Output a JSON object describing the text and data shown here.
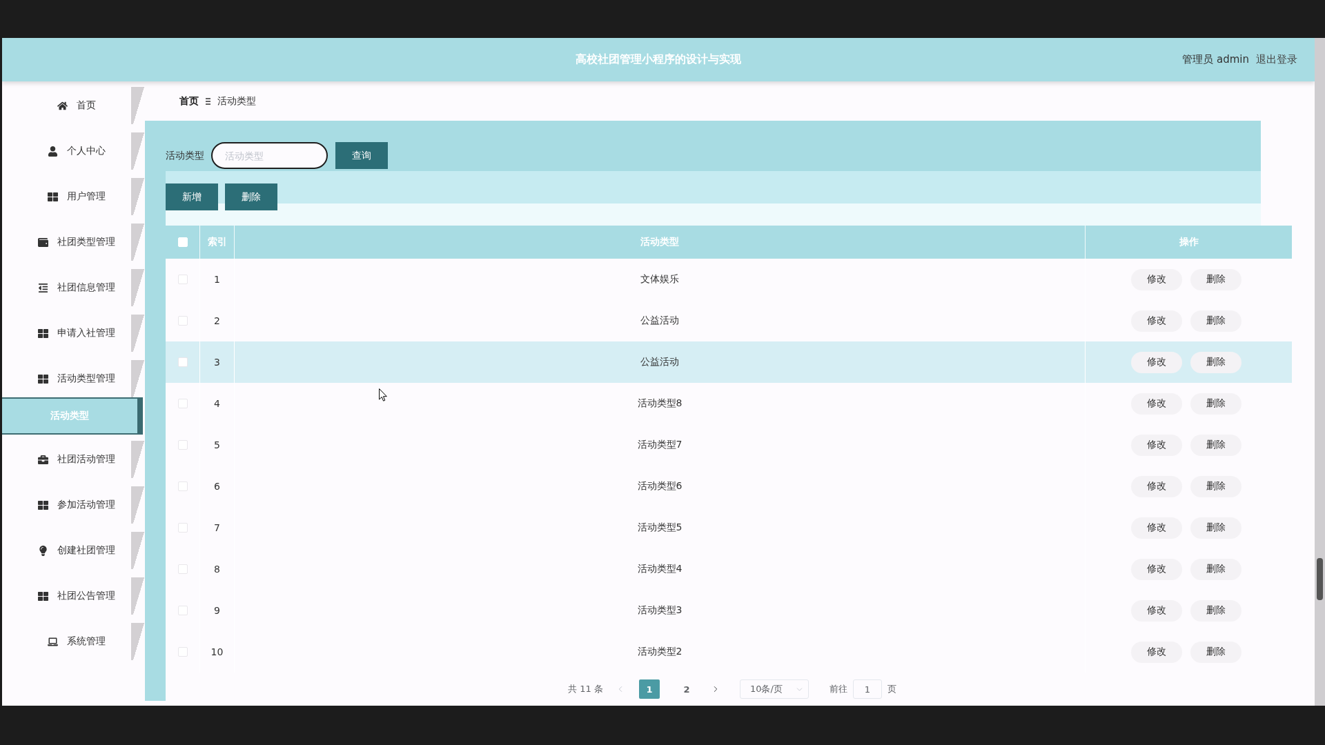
{
  "header": {
    "title": "高校社团管理小程序的设计与实现",
    "user": "管理员 admin",
    "logout": "退出登录"
  },
  "sidebar": {
    "items": [
      {
        "label": "首页",
        "selected": false
      },
      {
        "label": "个人中心",
        "selected": false
      },
      {
        "label": "用户管理",
        "selected": false
      },
      {
        "label": "社团类型管理",
        "selected": false
      },
      {
        "label": "社团信息管理",
        "selected": false
      },
      {
        "label": "申请入社管理",
        "selected": false
      },
      {
        "label": "活动类型管理",
        "selected": false,
        "children": [
          {
            "label": "活动类型",
            "selected": true
          }
        ]
      },
      {
        "label": "社团活动管理",
        "selected": false
      },
      {
        "label": "参加活动管理",
        "selected": false
      },
      {
        "label": "创建社团管理",
        "selected": false
      },
      {
        "label": "社团公告管理",
        "selected": false
      },
      {
        "label": "系统管理",
        "selected": false
      }
    ]
  },
  "breadcrumb": [
    {
      "kind": "link",
      "label": "首页"
    },
    {
      "kind": "current",
      "label": "活动类型"
    }
  ],
  "search": {
    "label": "活动类型",
    "placeholder": "活动类型",
    "button": "查询"
  },
  "actions": [
    "新增",
    "删除"
  ],
  "table": {
    "select_all": {
      "checked": false
    },
    "columns": [
      "索引",
      "活动类型",
      "操作"
    ],
    "rows": [
      {
        "checked": false,
        "hovered": false,
        "index": "1",
        "activity_type": "文体娱乐",
        "actions": [
          "修改",
          "删除"
        ]
      },
      {
        "checked": false,
        "hovered": false,
        "index": "2",
        "activity_type": "公益活动",
        "actions": [
          "修改",
          "删除"
        ]
      },
      {
        "checked": false,
        "hovered": true,
        "index": "3",
        "activity_type": "公益活动",
        "actions": [
          "修改",
          "删除"
        ]
      },
      {
        "checked": false,
        "hovered": false,
        "index": "4",
        "activity_type": "活动类型8",
        "actions": [
          "修改",
          "删除"
        ]
      },
      {
        "checked": false,
        "hovered": false,
        "index": "5",
        "activity_type": "活动类型7",
        "actions": [
          "修改",
          "删除"
        ]
      },
      {
        "checked": false,
        "hovered": false,
        "index": "6",
        "activity_type": "活动类型6",
        "actions": [
          "修改",
          "删除"
        ]
      },
      {
        "checked": false,
        "hovered": false,
        "index": "7",
        "activity_type": "活动类型5",
        "actions": [
          "修改",
          "删除"
        ]
      },
      {
        "checked": false,
        "hovered": false,
        "index": "8",
        "activity_type": "活动类型4",
        "actions": [
          "修改",
          "删除"
        ]
      },
      {
        "checked": false,
        "hovered": false,
        "index": "9",
        "activity_type": "活动类型3",
        "actions": [
          "修改",
          "删除"
        ]
      },
      {
        "checked": false,
        "hovered": false,
        "index": "10",
        "activity_type": "活动类型2",
        "actions": [
          "修改",
          "删除"
        ]
      }
    ]
  },
  "pagination": {
    "total": "共 11 条",
    "prev_disabled": true,
    "pages": [
      {
        "label": "1",
        "selected": true
      },
      {
        "label": "2",
        "selected": false
      }
    ],
    "next_disabled": false,
    "page_size": "10条/页",
    "jump_label": "前往",
    "jump_value": "1",
    "jump_unit": "页"
  }
}
